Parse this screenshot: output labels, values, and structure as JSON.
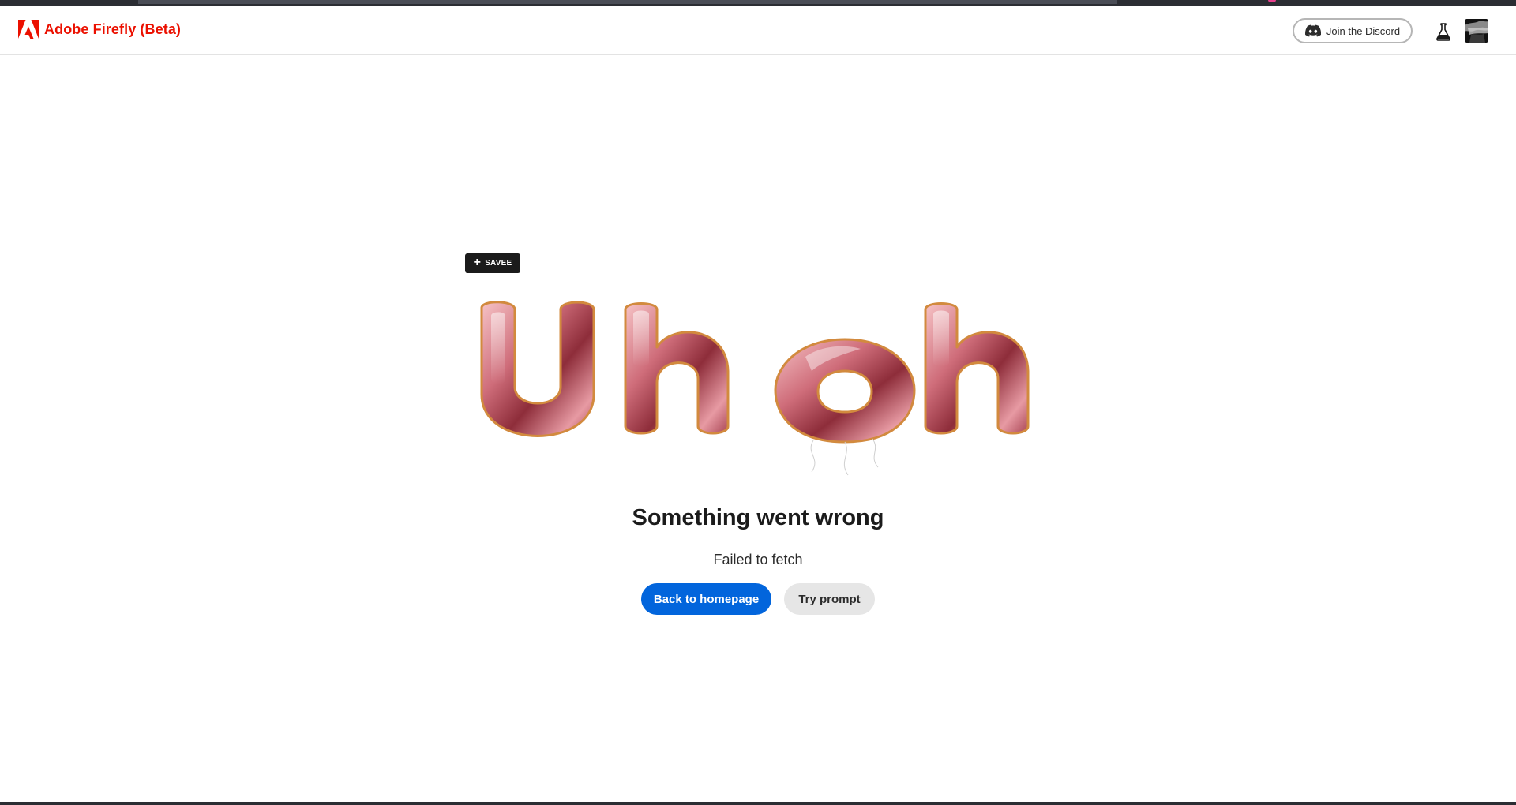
{
  "header": {
    "brand_name": "Adobe Firefly (Beta)",
    "brand_color": "#eb1000",
    "logo_icon": "adobe-logo-icon",
    "discord_label": "Join the Discord",
    "discord_icon": "discord-icon",
    "labs_icon": "flask-icon",
    "avatar_icon": "user-avatar"
  },
  "overlay": {
    "savee_label": "SAVEE"
  },
  "hero": {
    "image_text": "Uh oh",
    "colors": {
      "balloon_light": "#f3b3b8",
      "balloon_mid": "#c9606f",
      "balloon_dark": "#7a2430",
      "rim": "#d88a3c"
    }
  },
  "error": {
    "title": "Something went wrong",
    "message": "Failed to fetch",
    "primary_button": "Back to homepage",
    "secondary_button": "Try prompt",
    "primary_color": "#0265dc"
  }
}
